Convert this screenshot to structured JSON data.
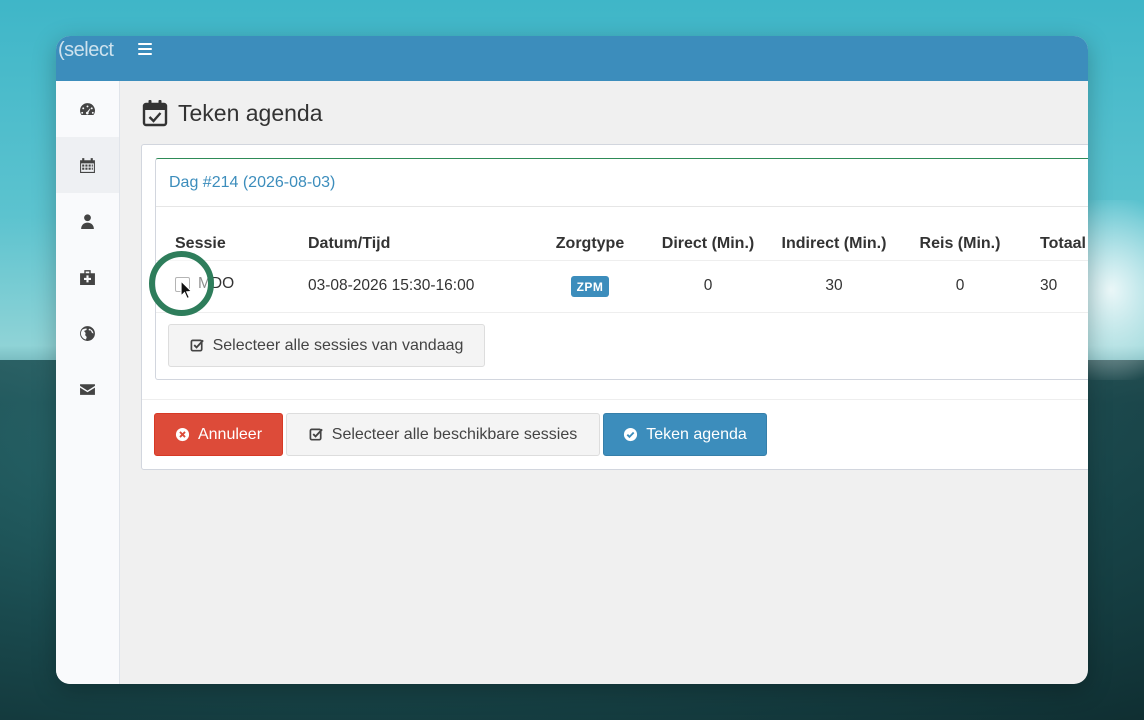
{
  "app": {
    "logo_text": "(select"
  },
  "sidebar": {
    "items": [
      {
        "icon": "dashboard-icon"
      },
      {
        "icon": "calendar-icon",
        "active": true
      },
      {
        "icon": "user-icon"
      },
      {
        "icon": "medkit-icon"
      },
      {
        "icon": "globe-icon"
      },
      {
        "icon": "envelope-icon"
      }
    ]
  },
  "page": {
    "title": "Teken agenda",
    "title_icon": "calendar-check-icon"
  },
  "day": {
    "header": "Dag #214 (2026-08-03)",
    "columns": [
      "Sessie",
      "Datum/Tijd",
      "Zorgtype",
      "Direct (Min.)",
      "Indirect (Min.)",
      "Reis (Min.)",
      "Totaal ("
    ],
    "rows": [
      {
        "sessie": "MDO",
        "datum": "03-08-2026 15:30-16:00",
        "zorgtype": "ZPM",
        "direct": "0",
        "indirect": "30",
        "reis": "0",
        "totaal": "30"
      }
    ],
    "select_today_label": "Selecteer alle sessies van vandaag"
  },
  "footer": {
    "cancel_label": "Annuleer",
    "select_all_label": "Selecteer alle beschikbare sessies",
    "sign_label": "Teken agenda"
  },
  "colors": {
    "primary": "#3c8dbc",
    "danger": "#dd4b39",
    "success_border": "#2e8b57"
  }
}
